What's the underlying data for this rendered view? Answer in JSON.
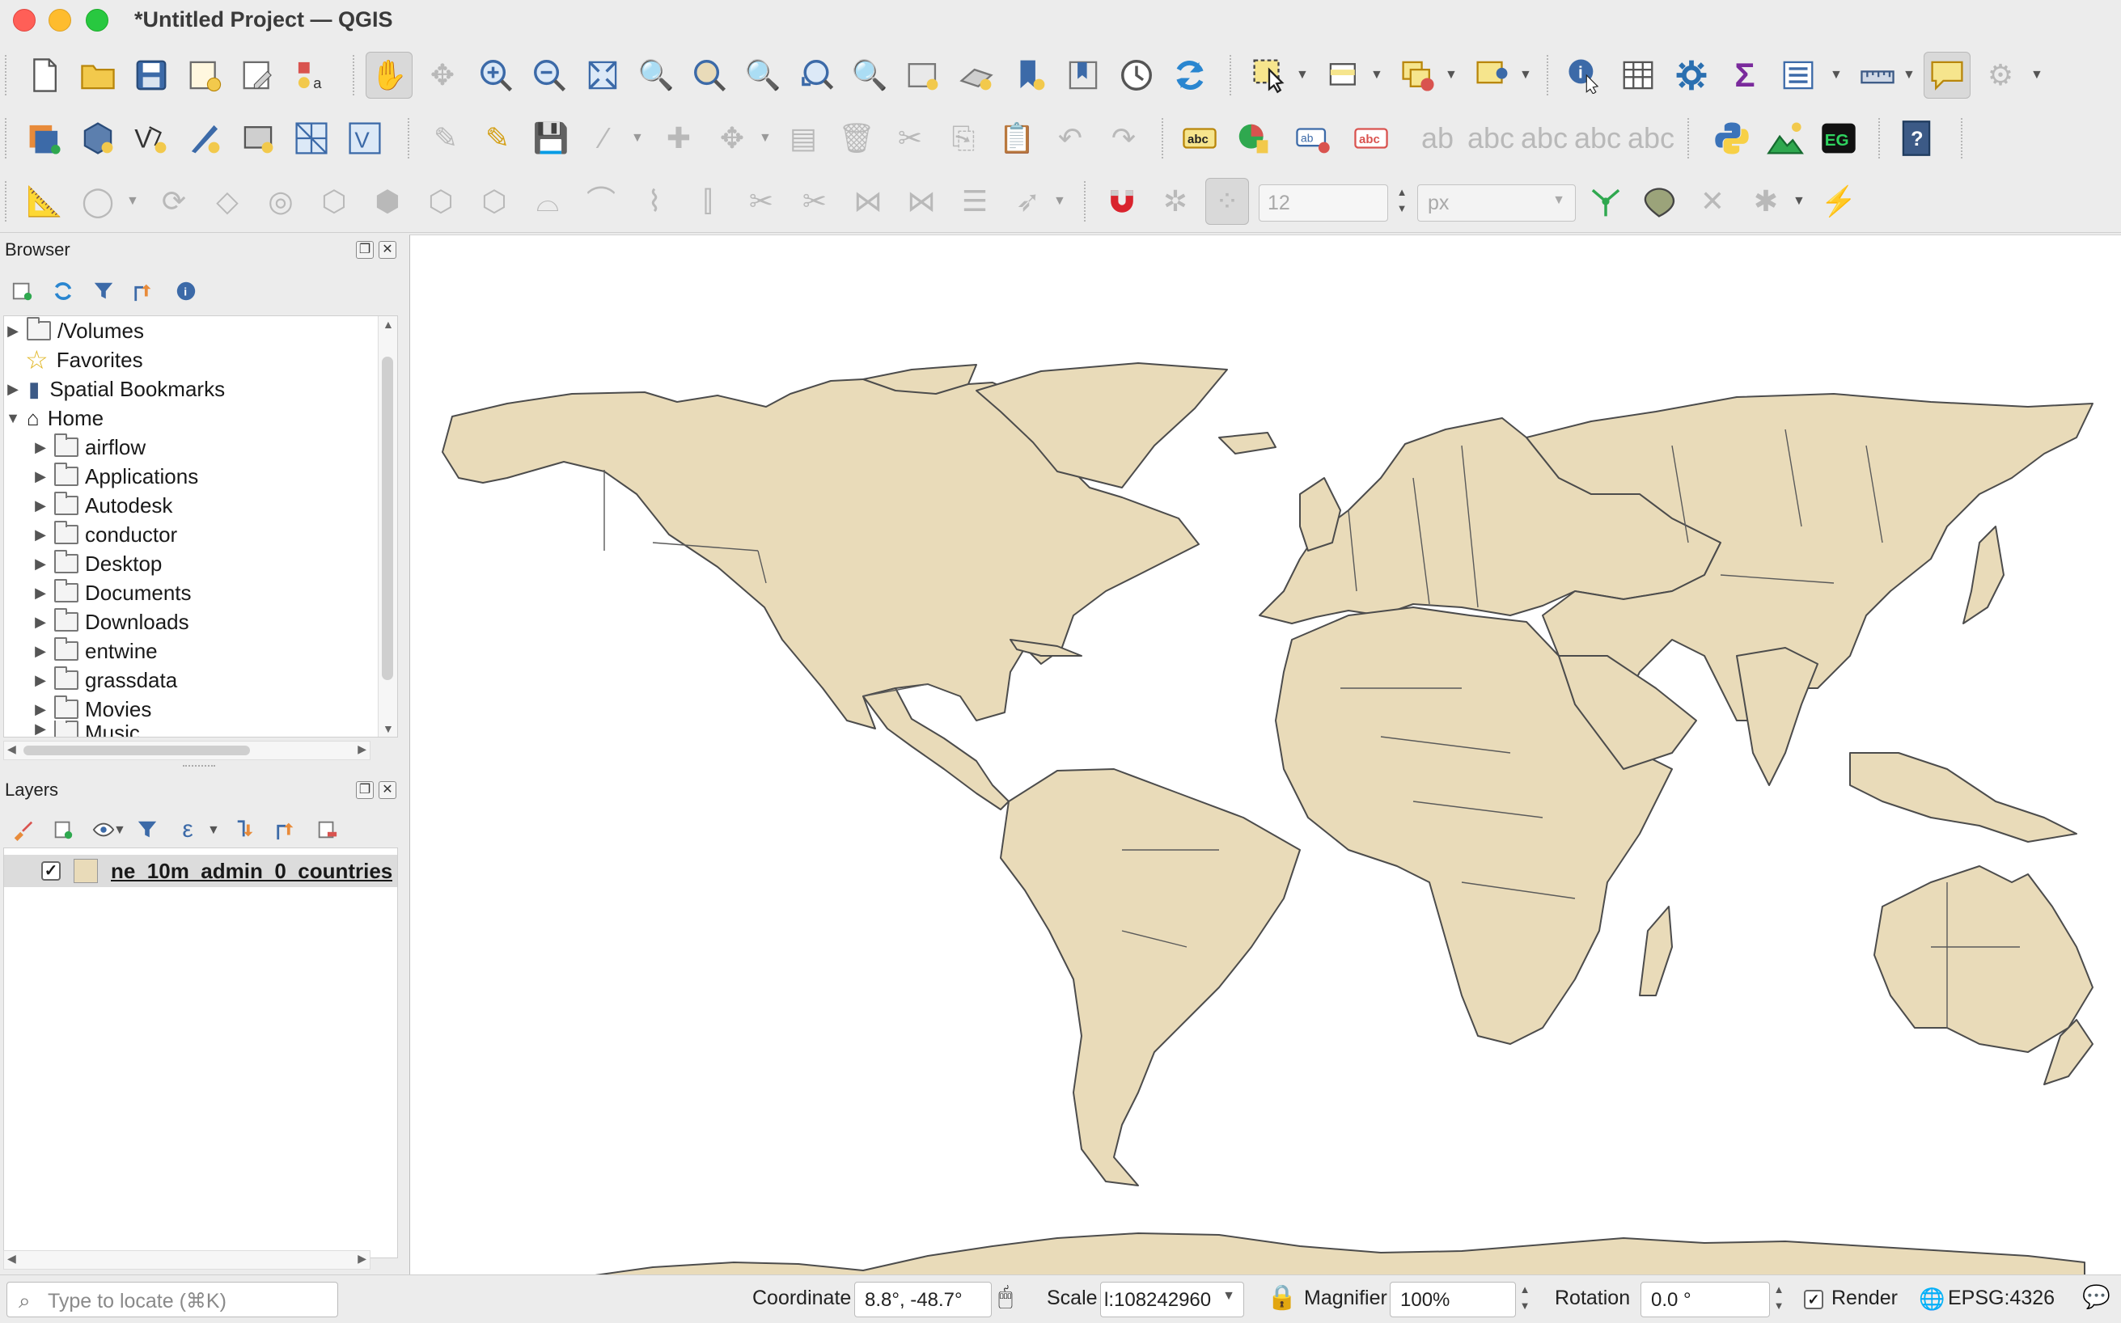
{
  "window": {
    "title": "*Untitled Project — QGIS"
  },
  "browser": {
    "title": "Browser",
    "items": [
      {
        "label": "/Volumes",
        "icon": "folder-icon",
        "expandable": true
      },
      {
        "label": "Favorites",
        "icon": "star-icon",
        "expandable": false
      },
      {
        "label": "Spatial Bookmarks",
        "icon": "bookmark-icon",
        "expandable": true
      },
      {
        "label": "Home",
        "icon": "home-icon",
        "expandable": true,
        "expanded": true
      },
      {
        "label": "airflow",
        "icon": "folder-icon",
        "indent": true
      },
      {
        "label": "Applications",
        "icon": "folder-icon",
        "indent": true
      },
      {
        "label": "Autodesk",
        "icon": "folder-icon",
        "indent": true
      },
      {
        "label": "conductor",
        "icon": "folder-icon",
        "indent": true
      },
      {
        "label": "Desktop",
        "icon": "folder-icon",
        "indent": true
      },
      {
        "label": "Documents",
        "icon": "folder-icon",
        "indent": true
      },
      {
        "label": "Downloads",
        "icon": "folder-icon",
        "indent": true
      },
      {
        "label": "entwine",
        "icon": "folder-icon",
        "indent": true
      },
      {
        "label": "grassdata",
        "icon": "folder-icon",
        "indent": true
      },
      {
        "label": "Movies",
        "icon": "folder-icon",
        "indent": true
      },
      {
        "label": "Music",
        "icon": "folder-icon",
        "indent": true
      }
    ]
  },
  "layers": {
    "title": "Layers",
    "items": [
      {
        "name": "ne_10m_admin_0_countries",
        "visible": true,
        "fill_color": "#e9dbb9"
      }
    ]
  },
  "digitizing": {
    "snap_tolerance": "12",
    "snap_unit": "px"
  },
  "statusbar": {
    "locator_placeholder": "Type to locate (⌘K)",
    "coordinate_label": "Coordinate",
    "coordinate_value": "8.8°, -48.7°",
    "scale_label": "Scale",
    "scale_value": "l:108242960",
    "magnifier_label": "Magnifier",
    "magnifier_value": "100%",
    "rotation_label": "Rotation",
    "rotation_value": "0.0 °",
    "render_label": "Render",
    "render_checked": true,
    "crs": "EPSG:4326"
  },
  "map": {
    "land_color": "#e9dbb9",
    "outline_color": "#4c4c4c",
    "background": "#ffffff"
  }
}
